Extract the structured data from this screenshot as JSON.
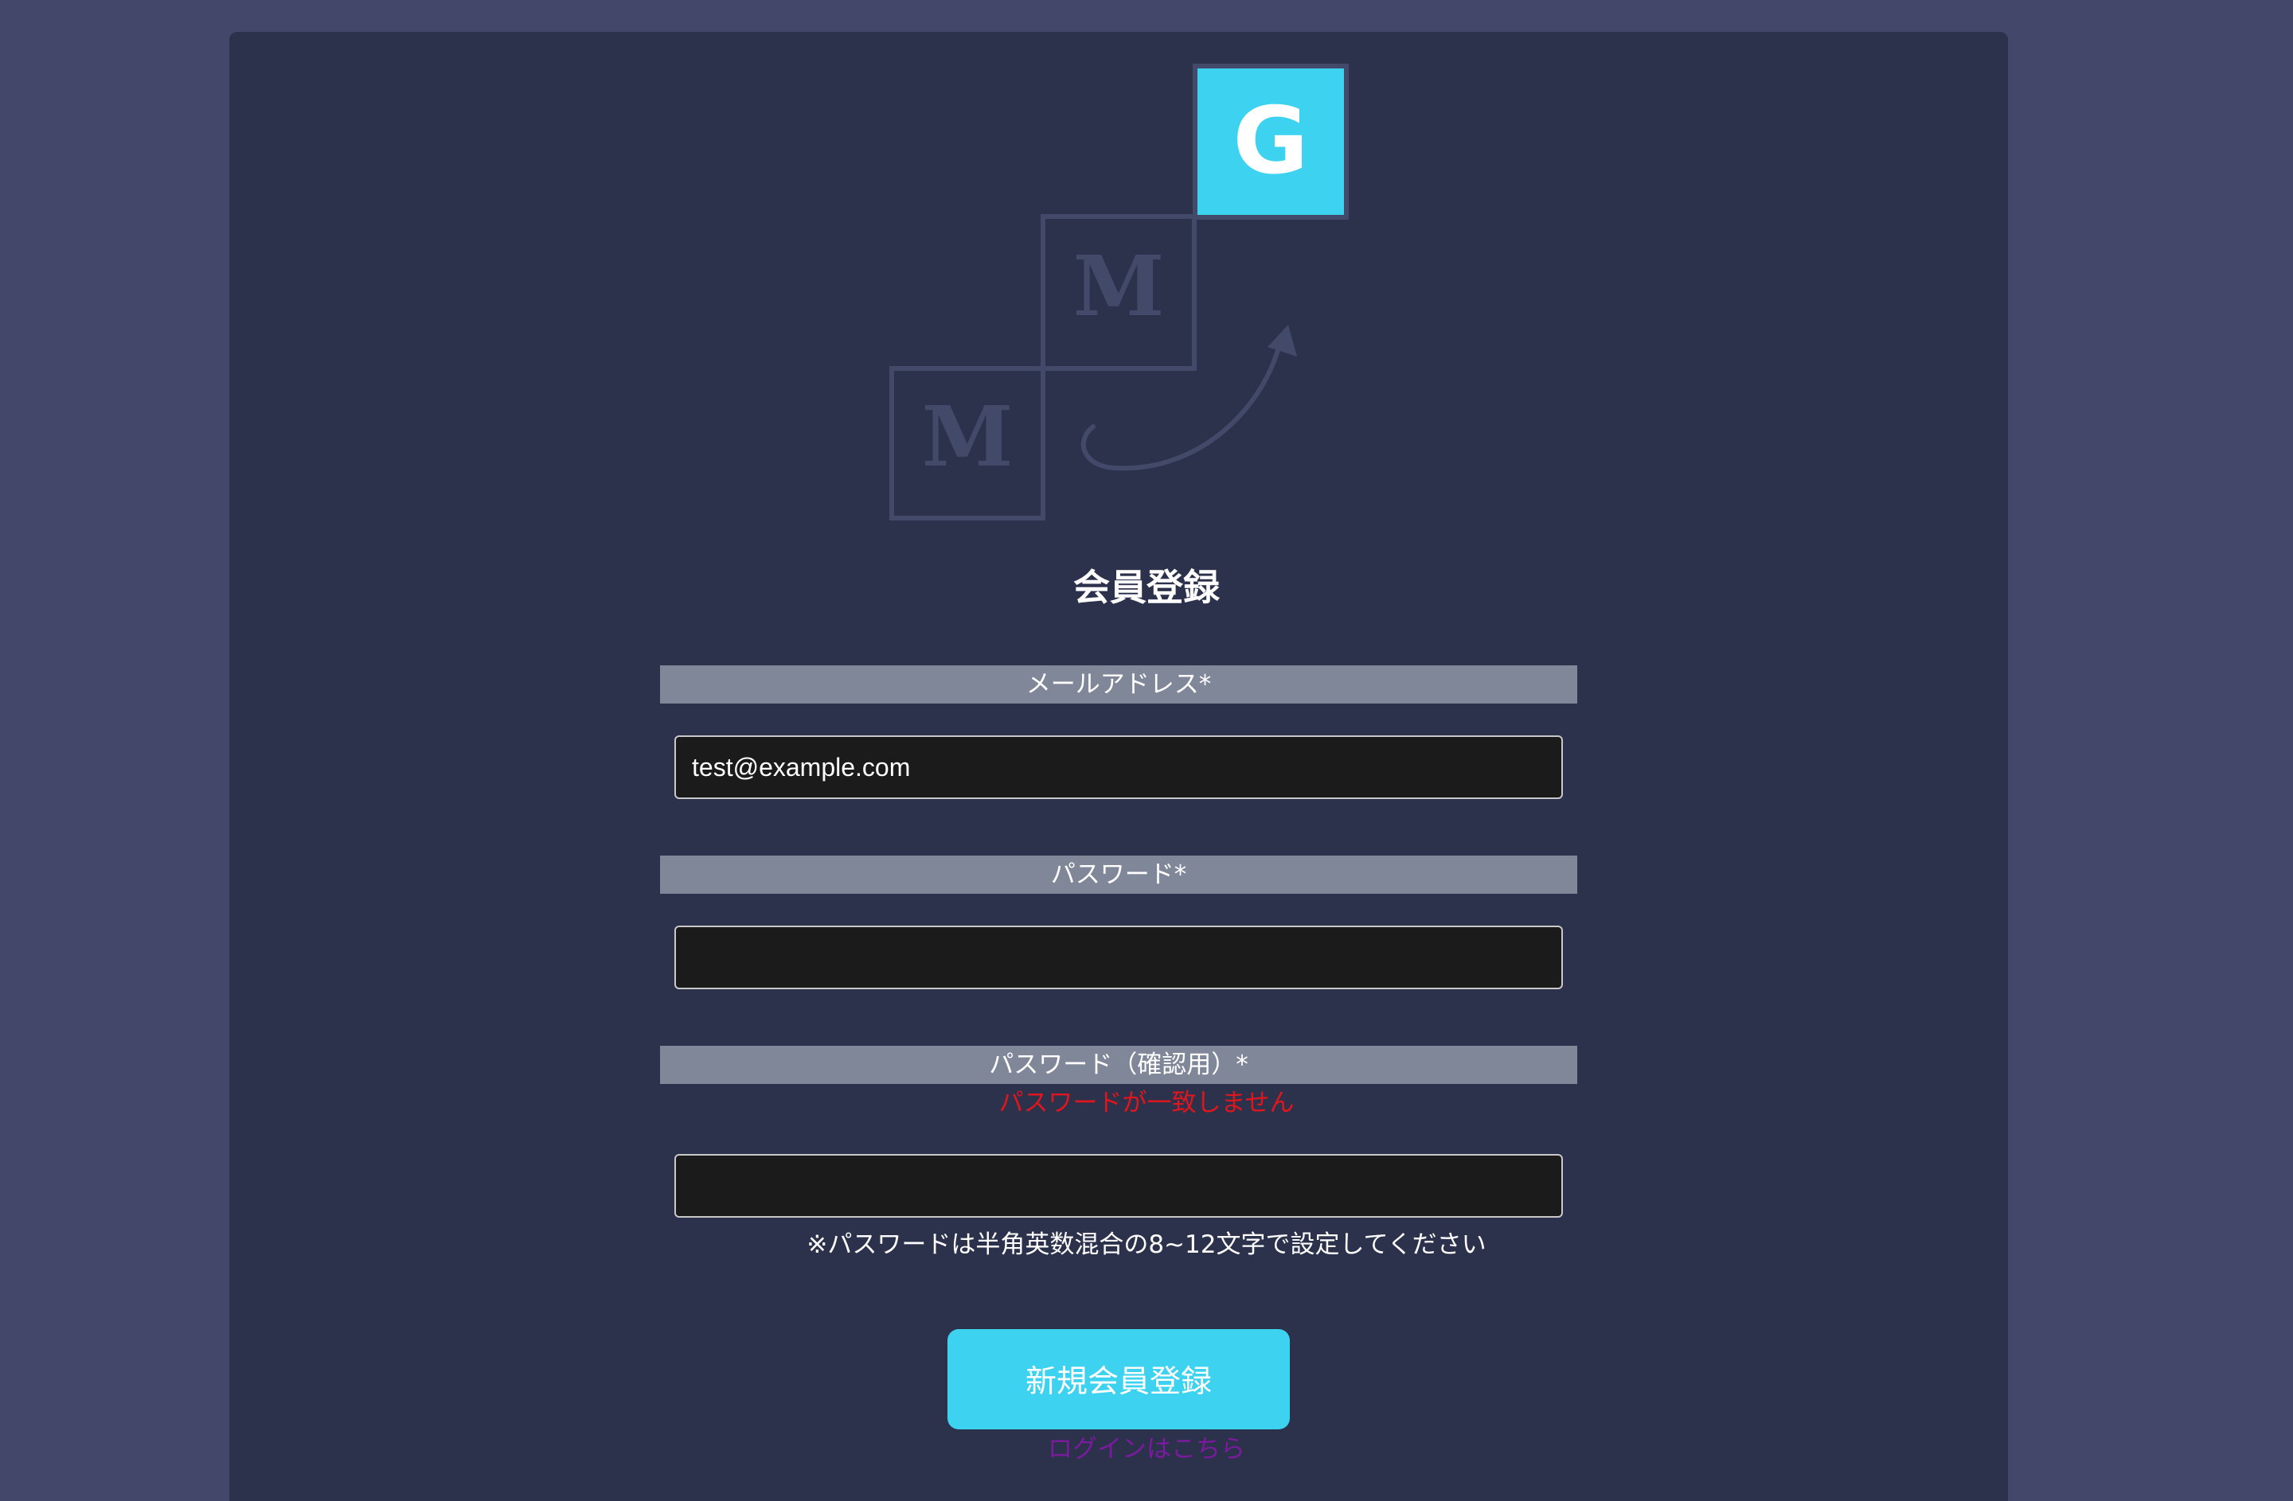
{
  "logo": {
    "tiles": [
      "M",
      "M",
      "G"
    ],
    "icon": "mmg-logo",
    "colors": {
      "accent": "#3dd2f0",
      "tile_outline": "#434969",
      "tile_letter": "#434969"
    }
  },
  "title": "会員登録",
  "form": {
    "email": {
      "label": "メールアドレス*",
      "value": "test@example.com",
      "placeholder": ""
    },
    "password": {
      "label": "パスワード*",
      "value": "",
      "placeholder": ""
    },
    "password_confirm": {
      "label": "パスワード（確認用）*",
      "value": "",
      "placeholder": "",
      "error": "パスワードが一致しません"
    },
    "hint": "※パスワードは半角英数混合の8~12文字で設定してください"
  },
  "submit_label": "新規会員登録",
  "login_link_label": "ログインはこちら",
  "colors": {
    "page_background": "#434769",
    "card_background": "#2c314c",
    "label_bar": "#808799",
    "input_background": "#1b1b1b",
    "button": "#3dd2f0",
    "error": "#e0161d",
    "link": "#7a1b9e"
  }
}
